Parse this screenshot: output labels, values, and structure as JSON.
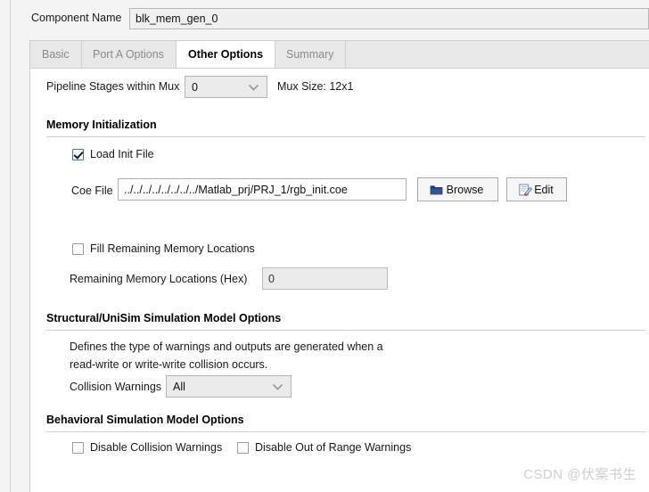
{
  "header": {
    "component_name_label": "Component Name",
    "component_name_value": "blk_mem_gen_0"
  },
  "tabs": [
    {
      "label": "Basic",
      "active": false
    },
    {
      "label": "Port A Options",
      "active": false
    },
    {
      "label": "Other Options",
      "active": true
    },
    {
      "label": "Summary",
      "active": false
    }
  ],
  "pipeline": {
    "label": "Pipeline Stages within Mux",
    "value": "0",
    "mux_size_text": "Mux Size: 12x1"
  },
  "memory_initialization": {
    "section_title": "Memory Initialization",
    "load_init_file_label": "Load Init File",
    "load_init_file_checked": true,
    "coe_file_label": "Coe File",
    "coe_file_value": "../../../../../../../../Matlab_prj/PRJ_1/rgb_init.coe",
    "browse_label": "Browse",
    "browse_icon": "folder-icon",
    "edit_label": "Edit",
    "edit_icon": "edit-pencil-icon",
    "fill_remaining_label": "Fill Remaining Memory Locations",
    "fill_remaining_checked": false,
    "remaining_locations_label": "Remaining Memory Locations (Hex)",
    "remaining_locations_value": "0",
    "remaining_locations_disabled": true
  },
  "structural": {
    "section_title": "Structural/UniSim Simulation Model Options",
    "description_line1": "Defines the type of warnings and outputs are generated when a",
    "description_line2": "read-write or write-write collision occurs.",
    "collision_warnings_label": "Collision Warnings",
    "collision_warnings_value": "All"
  },
  "behavioral": {
    "section_title": "Behavioral Simulation Model Options",
    "disable_collision_label": "Disable Collision Warnings",
    "disable_collision_checked": false,
    "disable_out_of_range_label": "Disable Out of Range Warnings",
    "disable_out_of_range_checked": false
  },
  "watermark": {
    "text": "CSDN @伏案书生"
  },
  "colors": {
    "accent_blue": "#3a76c4",
    "folder_icon": "#1f3f7a",
    "panel_bg": "#ffffff",
    "shell_bg": "#f4f4f4",
    "tab_inactive_text": "#8a8a8a"
  }
}
